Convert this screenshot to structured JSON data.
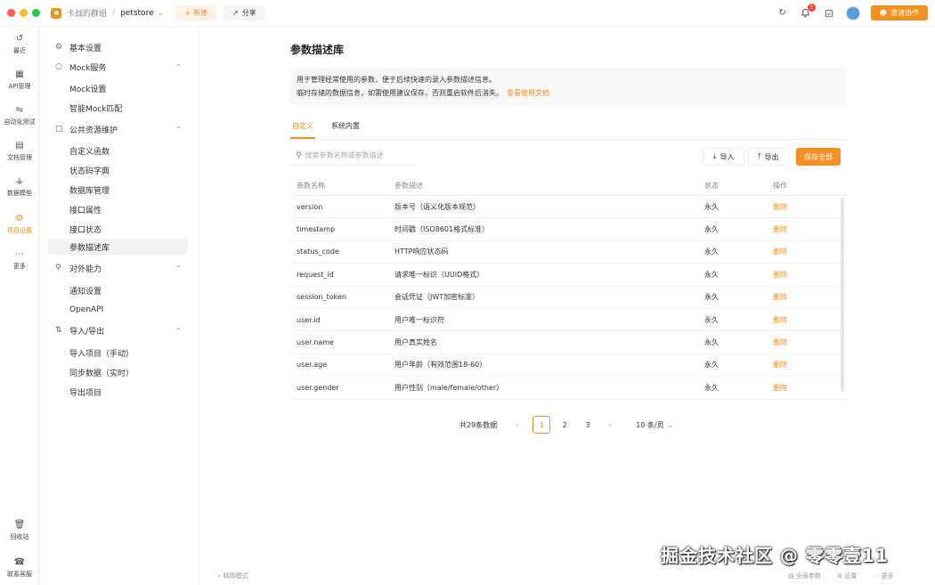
{
  "titlebar": {
    "team_name": "卡战的群组",
    "separator": "/",
    "project_name": "petstore",
    "new_label": "新建",
    "share_label": "分享",
    "notification_count": "3",
    "invite_label": "邀请协作"
  },
  "rail": {
    "items": [
      {
        "label": "最近",
        "icon": "history-icon"
      },
      {
        "label": "API管理",
        "icon": "api-icon"
      },
      {
        "label": "自动化测试",
        "icon": "automation-icon"
      },
      {
        "label": "文档管理",
        "icon": "doc-icon"
      },
      {
        "label": "数据模型",
        "icon": "model-icon"
      },
      {
        "label": "项目设置",
        "icon": "settings-icon"
      },
      {
        "label": "更多",
        "icon": "more-icon"
      }
    ],
    "bottom": [
      {
        "label": "回收站",
        "icon": "trash-icon"
      },
      {
        "label": "联系客服",
        "icon": "headset-icon"
      }
    ]
  },
  "sidebar": {
    "basic": "基本设置",
    "mock_group": "Mock服务",
    "mock_settings": "Mock设置",
    "smart_mock": "智能Mock匹配",
    "public_group": "公共资源维护",
    "custom_func": "自定义函数",
    "status_dict": "状态码字典",
    "db_manage": "数据库管理",
    "iface_attr": "接口属性",
    "iface_status": "接口状态",
    "param_lib": "参数描述库",
    "external_group": "对外能力",
    "notify": "通知设置",
    "openapi": "OpenAPI",
    "io_group": "导入/导出",
    "import_proj": "导入项目（手动）",
    "sync_data": "同步数据（实时）",
    "export_proj": "导出项目"
  },
  "main": {
    "title": "参数描述库",
    "info_line1": "用于管理经常使用的参数，便于后续快速的录入参数描述信息。",
    "info_line2": "临时存储的数据信息，如需使用建议保存，否则重启软件后消失。",
    "doc_link": "查看使用文档",
    "tab_custom": "自定义",
    "tab_builtin": "系统内置",
    "search_placeholder": "搜索参数名称或参数描述",
    "import_label": "导入",
    "export_label": "导出",
    "save_all_label": "保存全部"
  },
  "table": {
    "headers": [
      "参数名称",
      "参数描述",
      "状态",
      "操作"
    ],
    "rows": [
      {
        "name": "version",
        "desc": "版本号（语义化版本规范）",
        "status": "永久",
        "action": "删除"
      },
      {
        "name": "timestamp",
        "desc": "时间戳（ISO8601格式标准）",
        "status": "永久",
        "action": "删除"
      },
      {
        "name": "status_code",
        "desc": "HTTP响应状态码",
        "status": "永久",
        "action": "删除"
      },
      {
        "name": "request_id",
        "desc": "请求唯一标识（UUID格式）",
        "status": "永久",
        "action": "删除"
      },
      {
        "name": "session_token",
        "desc": "会话凭证（JWT加密标准）",
        "status": "永久",
        "action": "删除"
      },
      {
        "name": "user.id",
        "desc": "用户唯一标识符",
        "status": "永久",
        "action": "删除"
      },
      {
        "name": "user.name",
        "desc": "用户真实姓名",
        "status": "永久",
        "action": "删除"
      },
      {
        "name": "user.age",
        "desc": "用户年龄（有效范围18-60）",
        "status": "永久",
        "action": "删除"
      },
      {
        "name": "user.gender",
        "desc": "用户性别（male/female/other）",
        "status": "永久",
        "action": "删除"
      }
    ]
  },
  "pagination": {
    "total": "共29条数据",
    "pages": [
      "1",
      "2",
      "3"
    ],
    "current": "1",
    "page_size": "10 条/页"
  },
  "footer": {
    "left": "精简模式",
    "global_params": "全局参数",
    "settings": "设置",
    "more": "更多"
  },
  "watermark": "掘金技术社区 @ 零零壹11",
  "colors": {
    "accent": "#f29020",
    "danger_badge": "#f5412d"
  }
}
